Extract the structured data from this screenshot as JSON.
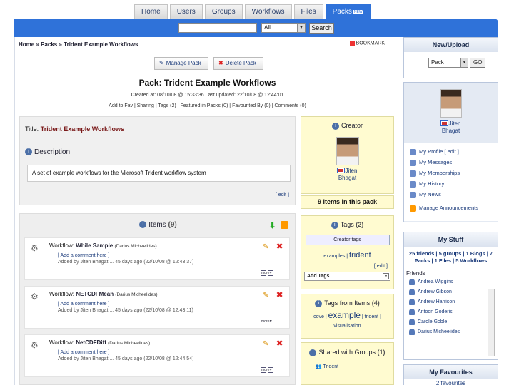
{
  "nav": {
    "tabs": [
      "Home",
      "Users",
      "Groups",
      "Workflows",
      "Files",
      "Packs"
    ],
    "new_badge": "NEW",
    "active_tab": "Packs"
  },
  "search": {
    "value": "",
    "category": "All",
    "button": "Search"
  },
  "breadcrumb": "Home » Packs » Trident Example Workflows",
  "bookmark": "BOOKMARK",
  "pack": {
    "manage_label": "Manage Pack",
    "delete_label": "Delete Pack",
    "heading": "Pack: Trident Example Workflows",
    "created": "Created at: 08/10/08 @ 15:33:36     Last updated: 22/10/08 @ 12:44:01",
    "actions": "Add to Fav | Sharing | Tags (2) | Featured in Packs (0) | Favourited By (0) | Comments (0)",
    "title_label": "Title:",
    "title_value": "Trident Example Workflows",
    "description_label": "Description",
    "description": "A set of example workflows for the Microsoft Trident workflow system",
    "edit": "[ edit ]"
  },
  "creator": {
    "heading": "Creator",
    "name_first": "Jiten",
    "name_last": "Bhagat"
  },
  "items_count_text": "9 items in this pack",
  "items": {
    "heading": "Items",
    "count": "(9)",
    "list": [
      {
        "label": "Workflow:",
        "name": "While Sample",
        "author": "(Darius Micheelides)",
        "comment": "[ Add a comment here ]",
        "added": "Added by Jiten Bhagat ... 45 days ago (22/10/08 @ 12:43:37)",
        "more": "more"
      },
      {
        "label": "Workflow:",
        "name": "NETCDFMean",
        "author": "(Darius Micheelides)",
        "comment": "[ Add a comment here ]",
        "added": "Added by Jiten Bhagat ... 45 days ago (22/10/08 @ 12:43:11)",
        "more": "more"
      },
      {
        "label": "Workflow:",
        "name": "NetCDFDiff",
        "author": "(Darius Micheelides)",
        "comment": "[ Add a comment here ]",
        "added": "Added by Jiten Bhagat ... 45 days ago (22/10/08 @ 12:44:54)",
        "more": "more"
      }
    ]
  },
  "tags": {
    "heading": "Tags",
    "count": "(2)",
    "creator_tags": "Creator tags",
    "tag1": "examples",
    "tag2": "trident",
    "edit": "[ edit ]",
    "add_tags": "Add Tags"
  },
  "tags_from_items": {
    "heading": "Tags from Items",
    "count": "(4)",
    "t1": "cove",
    "t2": "example",
    "t3": "trident",
    "t4": "visualisation"
  },
  "shared": {
    "heading": "Shared with Groups",
    "count": "(1)",
    "group": "Trident"
  },
  "sidebar": {
    "upload_heading": "New/Upload",
    "upload_value": "Pack",
    "go": "GO",
    "profile_first": "Jiten",
    "profile_last": "Bhagat",
    "links": [
      "My Profile [ edit ]",
      "My Messages",
      "My Memberships",
      "My History",
      "My News",
      "Manage Announcements"
    ],
    "mystuff_heading": "My Stuff",
    "mystuff_summary": "25 friends | 5 groups | 1 Blogs | 7 Packs | 1 Files | 5 Workflows",
    "friends_heading": "Friends",
    "friends": [
      "Andrea Wiggins",
      "Andrew Gibson",
      "Andrew Harrison",
      "Antoon Goderis",
      "Carole Goble",
      "Darius Micheelides"
    ],
    "favs_heading": "My Favourites",
    "favs_sub": "2 favourites"
  }
}
